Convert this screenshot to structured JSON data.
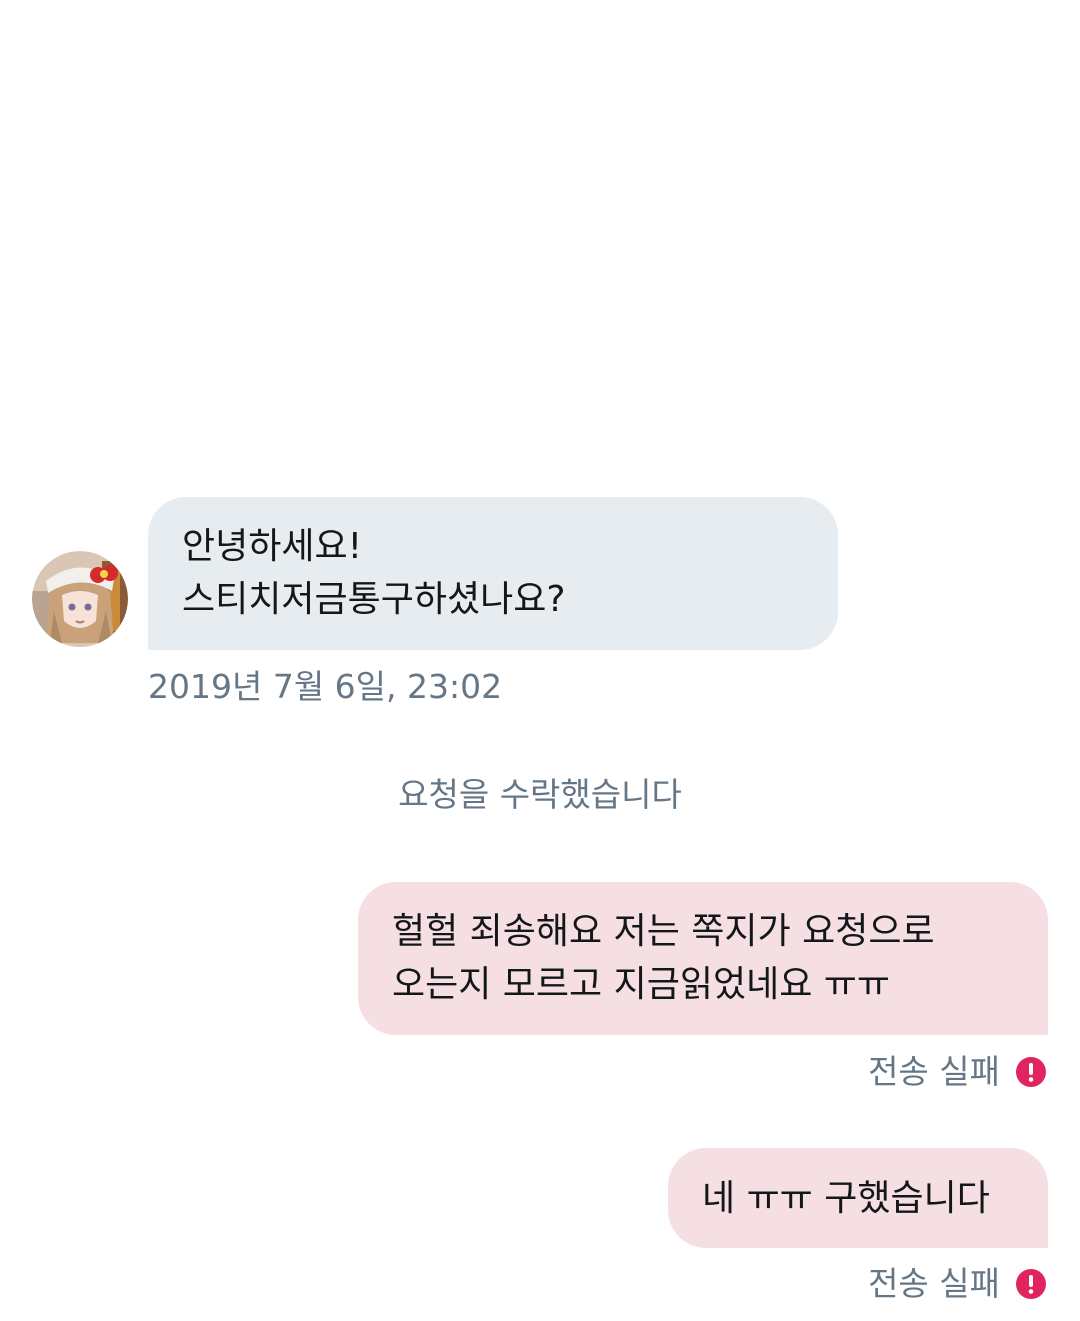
{
  "messages": [
    {
      "direction": "incoming",
      "text": "안녕하세요!\n스티치저금통구하셨나요?",
      "timestamp": "2019년 7월 6일, 23:02"
    },
    {
      "direction": "outgoing",
      "text": "헐헐 죄송해요 저는 쪽지가 요청으로\n오는지 모르고 지금읽었네요 ㅠㅠ",
      "status": "전송 실패"
    },
    {
      "direction": "outgoing",
      "text": "네 ㅠㅠ 구했습니다",
      "status": "전송 실패"
    }
  ],
  "system_note": "요청을 수락했습니다",
  "icons": {
    "avatar": "avatar-image",
    "send_failed": "error-icon"
  },
  "colors": {
    "incoming_bubble": "#e6ecf0",
    "outgoing_bubble": "#f5dfe3",
    "meta_text": "#657786",
    "error": "#e0245e"
  }
}
